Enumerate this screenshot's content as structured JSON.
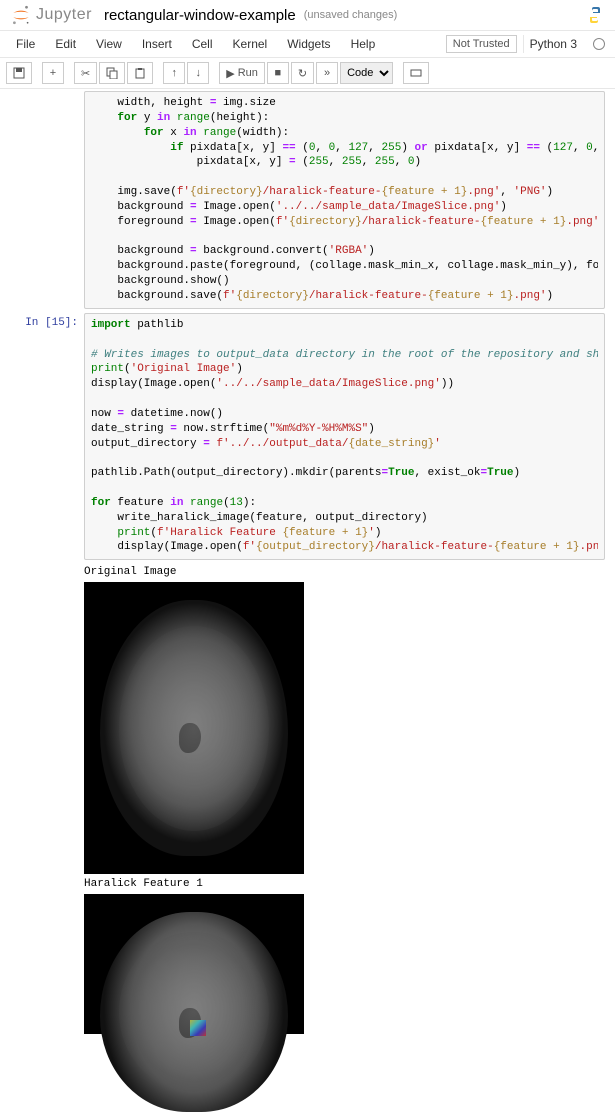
{
  "header": {
    "logo_text": "Jupyter",
    "notebook_name": "rectangular-window-example",
    "save_status": "(unsaved changes)"
  },
  "menubar": {
    "items": [
      "File",
      "Edit",
      "View",
      "Insert",
      "Cell",
      "Kernel",
      "Widgets",
      "Help"
    ],
    "trust_label": "Not Trusted",
    "kernel_label": "Python 3"
  },
  "toolbar": {
    "save_title": "Save and Checkpoint",
    "add_title": "insert cell below",
    "cut_title": "cut selected cells",
    "copy_title": "copy selected cells",
    "paste_title": "paste cells below",
    "up_title": "move selected cells up",
    "down_title": "move selected cells down",
    "run_label": "Run",
    "stop_title": "interrupt the kernel",
    "restart_title": "restart the kernel",
    "ff_title": "restart and run all",
    "celltype_selected": "Code",
    "cmd_title": "open the command palette"
  },
  "cell1_prompt": "",
  "cell2": {
    "prompt": "In [15]:"
  },
  "output": {
    "label1": "Original Image",
    "label2": "Haralick Feature 1"
  }
}
